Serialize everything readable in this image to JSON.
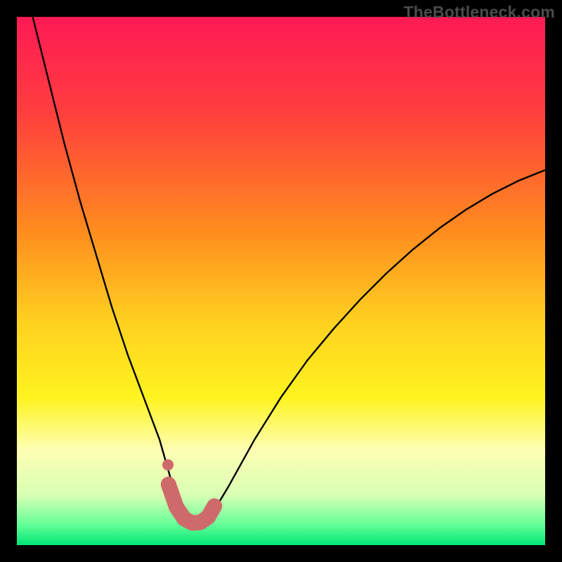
{
  "watermark": "TheBottleneck.com",
  "chart_data": {
    "type": "line",
    "title": "",
    "xlabel": "",
    "ylabel": "",
    "xlim": [
      0,
      100
    ],
    "ylim": [
      0,
      100
    ],
    "gradient_stops": [
      {
        "offset": 0.0,
        "color": "#ff1a55"
      },
      {
        "offset": 0.18,
        "color": "#ff3e3e"
      },
      {
        "offset": 0.4,
        "color": "#ff8a1f"
      },
      {
        "offset": 0.58,
        "color": "#ffd21f"
      },
      {
        "offset": 0.72,
        "color": "#fff31f"
      },
      {
        "offset": 0.82,
        "color": "#fdffb3"
      },
      {
        "offset": 0.905,
        "color": "#d9ffb3"
      },
      {
        "offset": 0.96,
        "color": "#66ff99"
      },
      {
        "offset": 1.0,
        "color": "#00e676"
      }
    ],
    "series": [
      {
        "name": "bottleneck-curve",
        "x": [
          3,
          6,
          9,
          12,
          15,
          18,
          21,
          24,
          27,
          29,
          30.5,
          32,
          33.5,
          35,
          37,
          40,
          45,
          50,
          55,
          60,
          65,
          70,
          75,
          80,
          85,
          90,
          95,
          100
        ],
        "values": [
          100,
          88,
          76,
          65,
          55,
          45,
          36,
          28,
          20,
          13,
          9,
          6,
          4,
          4,
          6,
          11,
          20,
          28,
          35,
          41,
          46.5,
          51.5,
          56,
          60,
          63.5,
          66.5,
          69,
          71
        ]
      }
    ],
    "highlight_band": {
      "name": "optimal-region",
      "color": "#cf6a6a",
      "x": [
        28.7,
        30.2,
        31.7,
        33.2,
        34.7,
        36.2,
        37.4
      ],
      "values": [
        11.5,
        7.2,
        5.0,
        4.2,
        4.3,
        5.3,
        7.4
      ]
    },
    "highlight_dot": {
      "name": "marker-dot",
      "color": "#cf6a6a",
      "x": 28.6,
      "value": 15.2
    }
  }
}
